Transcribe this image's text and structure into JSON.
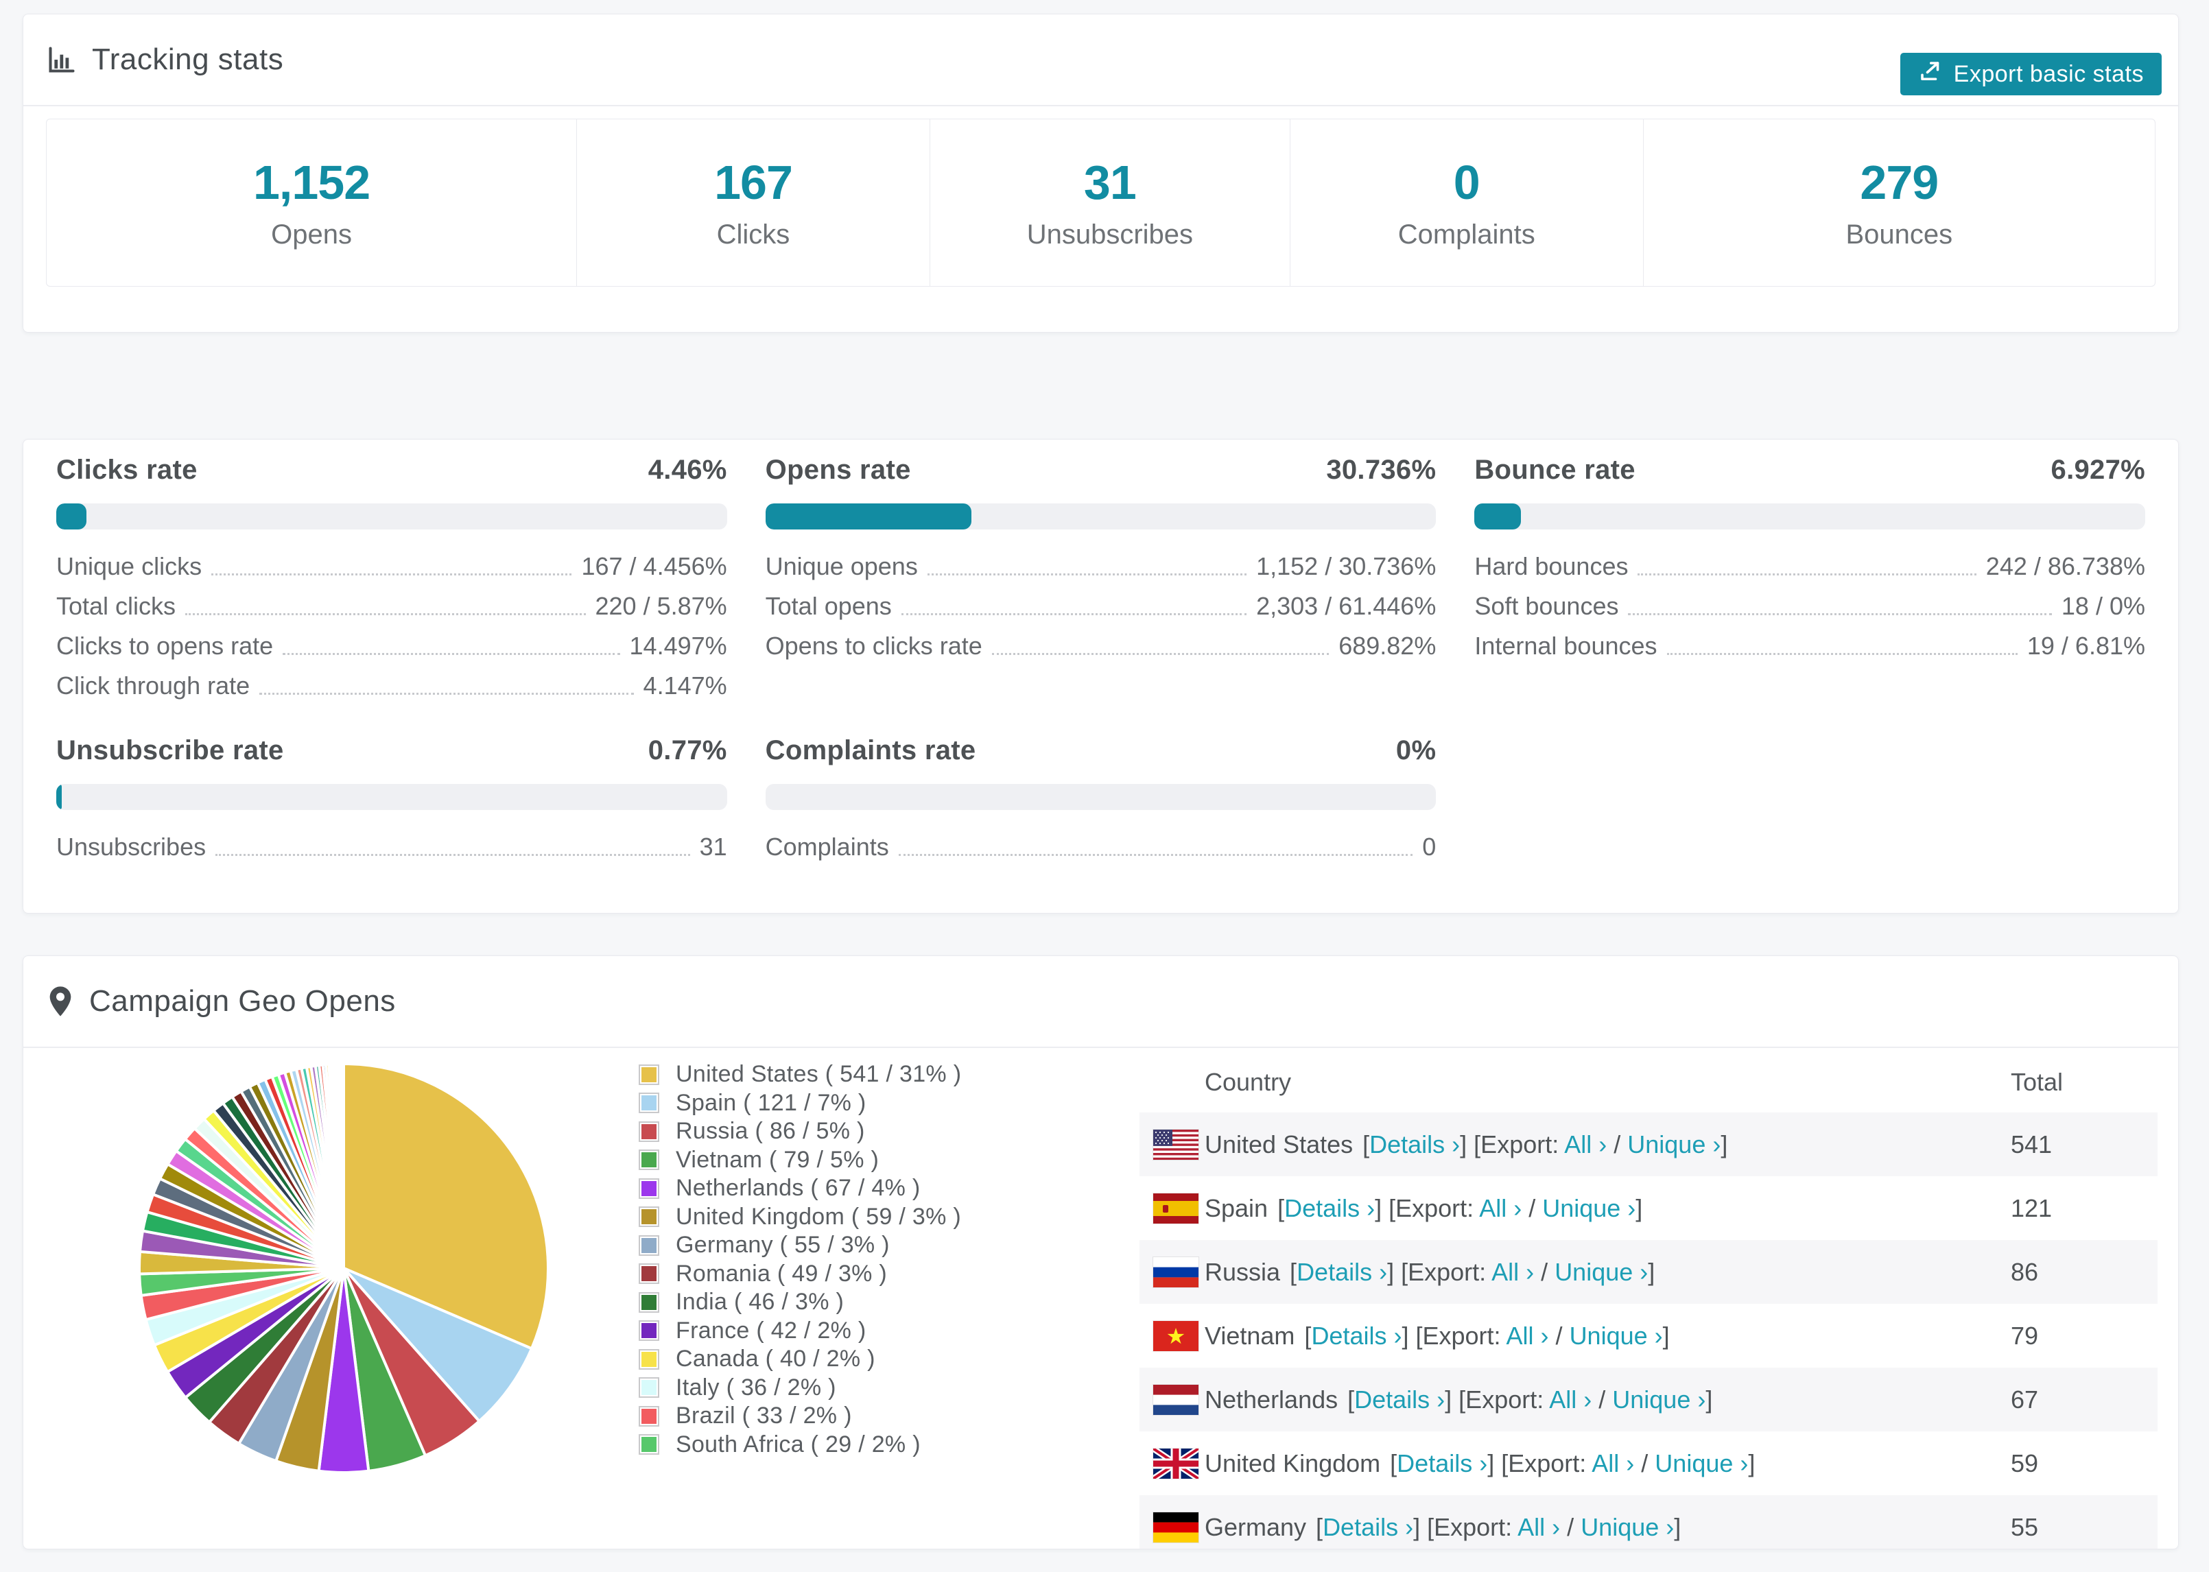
{
  "colors": {
    "accent": "#128CA2",
    "link": "#1D9EB5",
    "page_bg": "#F6F7F9",
    "card_border": "#E9EAEF",
    "bar_track": "#EFF0F3",
    "row_stripe": "#F6F6F8"
  },
  "header": {
    "title": "Tracking stats",
    "export_button": "Export basic stats"
  },
  "overview": [
    {
      "value": "1,152",
      "label": "Opens"
    },
    {
      "value": "167",
      "label": "Clicks"
    },
    {
      "value": "31",
      "label": "Unsubscribes"
    },
    {
      "value": "0",
      "label": "Complaints"
    },
    {
      "value": "279",
      "label": "Bounces"
    }
  ],
  "rates": [
    {
      "title": "Clicks rate",
      "value": "4.46%",
      "percent": 4.46,
      "col": 1,
      "row": 1,
      "rows": [
        {
          "label": "Unique clicks",
          "value": "167 / 4.456%"
        },
        {
          "label": "Total clicks",
          "value": "220 / 5.87%"
        },
        {
          "label": "Clicks to opens rate",
          "value": "14.497%"
        },
        {
          "label": "Click through rate",
          "value": "4.147%"
        }
      ]
    },
    {
      "title": "Opens rate",
      "value": "30.736%",
      "percent": 30.736,
      "col": 2,
      "row": 1,
      "rows": [
        {
          "label": "Unique opens",
          "value": "1,152 / 30.736%"
        },
        {
          "label": "Total opens",
          "value": "2,303 / 61.446%"
        },
        {
          "label": "Opens to clicks rate",
          "value": "689.82%"
        }
      ]
    },
    {
      "title": "Bounce rate",
      "value": "6.927%",
      "percent": 6.927,
      "col": 3,
      "row": 1,
      "rows": [
        {
          "label": "Hard bounces",
          "value": "242 / 86.738%"
        },
        {
          "label": "Soft bounces",
          "value": "18 / 0%"
        },
        {
          "label": "Internal bounces",
          "value": "19 / 6.81%"
        }
      ]
    },
    {
      "title": "Unsubscribe rate",
      "value": "0.77%",
      "percent": 0.77,
      "col": 1,
      "row": 2,
      "rows": [
        {
          "label": "Unsubscribes",
          "value": "31"
        }
      ]
    },
    {
      "title": "Complaints rate",
      "value": "0%",
      "percent": 0,
      "col": 2,
      "row": 2,
      "rows": [
        {
          "label": "Complaints",
          "value": "0"
        }
      ]
    }
  ],
  "geo": {
    "title": "Campaign Geo Opens",
    "legend": [
      {
        "label": "United States ( 541 / 31% )",
        "color": "#E6C14A"
      },
      {
        "label": "Spain ( 121 / 7% )",
        "color": "#A8D4F0"
      },
      {
        "label": "Russia ( 86 / 5% )",
        "color": "#C84B50"
      },
      {
        "label": "Vietnam ( 79 / 5% )",
        "color": "#4AA84E"
      },
      {
        "label": "Netherlands ( 67 / 4% )",
        "color": "#9C37EC"
      },
      {
        "label": "United Kingdom ( 59 / 3% )",
        "color": "#B6932B"
      },
      {
        "label": "Germany ( 55 / 3% )",
        "color": "#8FABC8"
      },
      {
        "label": "Romania ( 49 / 3% )",
        "color": "#A13A3E"
      },
      {
        "label": "India ( 46 / 3% )",
        "color": "#2F7D36"
      },
      {
        "label": "France ( 42 / 2% )",
        "color": "#7327BE"
      },
      {
        "label": "Canada ( 40 / 2% )",
        "color": "#F7E24A"
      },
      {
        "label": "Italy ( 36 / 2% )",
        "color": "#D8FBFB"
      },
      {
        "label": "Brazil ( 33 / 2% )",
        "color": "#F25C60"
      },
      {
        "label": "South Africa ( 29 / 2% )",
        "color": "#57C86B"
      }
    ],
    "table": {
      "columns": [
        "Country",
        "Total"
      ],
      "link_labels": {
        "details": "Details ›",
        "export": "Export:",
        "all": "All ›",
        "unique": "Unique ›"
      },
      "rows": [
        {
          "country": "United States",
          "flag": "us",
          "total": "541"
        },
        {
          "country": "Spain",
          "flag": "es",
          "total": "121"
        },
        {
          "country": "Russia",
          "flag": "ru",
          "total": "86"
        },
        {
          "country": "Vietnam",
          "flag": "vn",
          "total": "79"
        },
        {
          "country": "Netherlands",
          "flag": "nl",
          "total": "67"
        },
        {
          "country": "United Kingdom",
          "flag": "gb",
          "total": "59"
        },
        {
          "country": "Germany",
          "flag": "de",
          "total": "55"
        }
      ]
    },
    "chart_data": {
      "type": "pie",
      "title": "Campaign Geo Opens",
      "legend_position": "right",
      "series": [
        {
          "name": "United States",
          "value": 541,
          "pct": 31,
          "color": "#E6C14A"
        },
        {
          "name": "Spain",
          "value": 121,
          "pct": 7,
          "color": "#A8D4F0"
        },
        {
          "name": "Russia",
          "value": 86,
          "pct": 5,
          "color": "#C84B50"
        },
        {
          "name": "Vietnam",
          "value": 79,
          "pct": 5,
          "color": "#4AA84E"
        },
        {
          "name": "Netherlands",
          "value": 67,
          "pct": 4,
          "color": "#9C37EC"
        },
        {
          "name": "United Kingdom",
          "value": 59,
          "pct": 3,
          "color": "#B6932B"
        },
        {
          "name": "Germany",
          "value": 55,
          "pct": 3,
          "color": "#8FABC8"
        },
        {
          "name": "Romania",
          "value": 49,
          "pct": 3,
          "color": "#A13A3E"
        },
        {
          "name": "India",
          "value": 46,
          "pct": 3,
          "color": "#2F7D36"
        },
        {
          "name": "France",
          "value": 42,
          "pct": 2,
          "color": "#7327BE"
        },
        {
          "name": "Canada",
          "value": 40,
          "pct": 2,
          "color": "#F7E24A"
        },
        {
          "name": "Italy",
          "value": 36,
          "pct": 2,
          "color": "#D8FBFB"
        },
        {
          "name": "Brazil",
          "value": 33,
          "pct": 2,
          "color": "#F25C60"
        },
        {
          "name": "South Africa",
          "value": 29,
          "pct": 2,
          "color": "#57C86B"
        }
      ],
      "minor_slices": {
        "values": [
          30,
          28,
          26,
          25,
          23,
          22,
          21,
          20,
          19,
          18,
          17,
          16,
          15,
          14,
          13,
          12,
          11,
          10,
          9,
          9,
          8,
          8,
          7,
          7,
          6,
          6,
          5,
          5,
          4,
          4,
          3,
          3,
          3,
          2,
          2,
          2,
          2,
          1,
          1,
          1
        ],
        "colors": [
          "#D9B93C",
          "#9B59B6",
          "#27AE60",
          "#E74C3C",
          "#5D6D7E",
          "#A08A0B",
          "#E06DE0",
          "#58D68D",
          "#FF6B6B",
          "#E8FBF5",
          "#F5F54D",
          "#2E4053",
          "#196F3D",
          "#7B241C",
          "#546E7A",
          "#8A7A0F",
          "#85C1E9",
          "#E53935",
          "#66FF7A",
          "#D34DE0",
          "#C9A227",
          "#AED6F1",
          "#F1948A",
          "#48C9B0",
          "#F5CB5C",
          "#AF7AC5",
          "#45B39D",
          "#EC7063",
          "#5499C7",
          "#F4D03F",
          "#76448A",
          "#1E8449",
          "#922B21",
          "#34495E",
          "#B7950B",
          "#D98880",
          "#7FB3D5",
          "#52BE80",
          "#C39BD3",
          "#F0B27A"
        ]
      }
    }
  }
}
